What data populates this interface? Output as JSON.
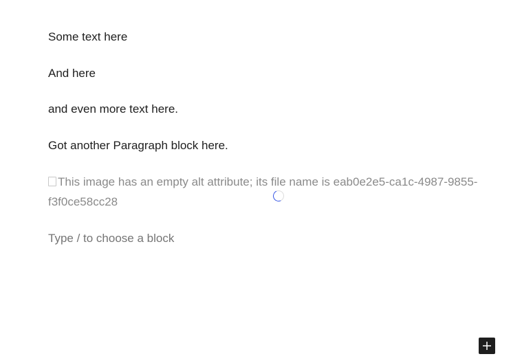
{
  "paragraphs": [
    "Some text here",
    "And here",
    "and even more text here.",
    "Got another Paragraph block here."
  ],
  "image_block": {
    "alt_text": "This image has an empty alt attribute; its file name is eab0e2e5-ca1c-4987-9855-f3f0ce58cc28",
    "icon": "broken-image-icon",
    "loading_icon": "spinner-icon",
    "spinner_color": "#3858e9"
  },
  "empty_block": {
    "placeholder": "Type / to choose a block"
  },
  "inserter": {
    "icon": "plus-icon",
    "background": "#1e1e1e"
  }
}
